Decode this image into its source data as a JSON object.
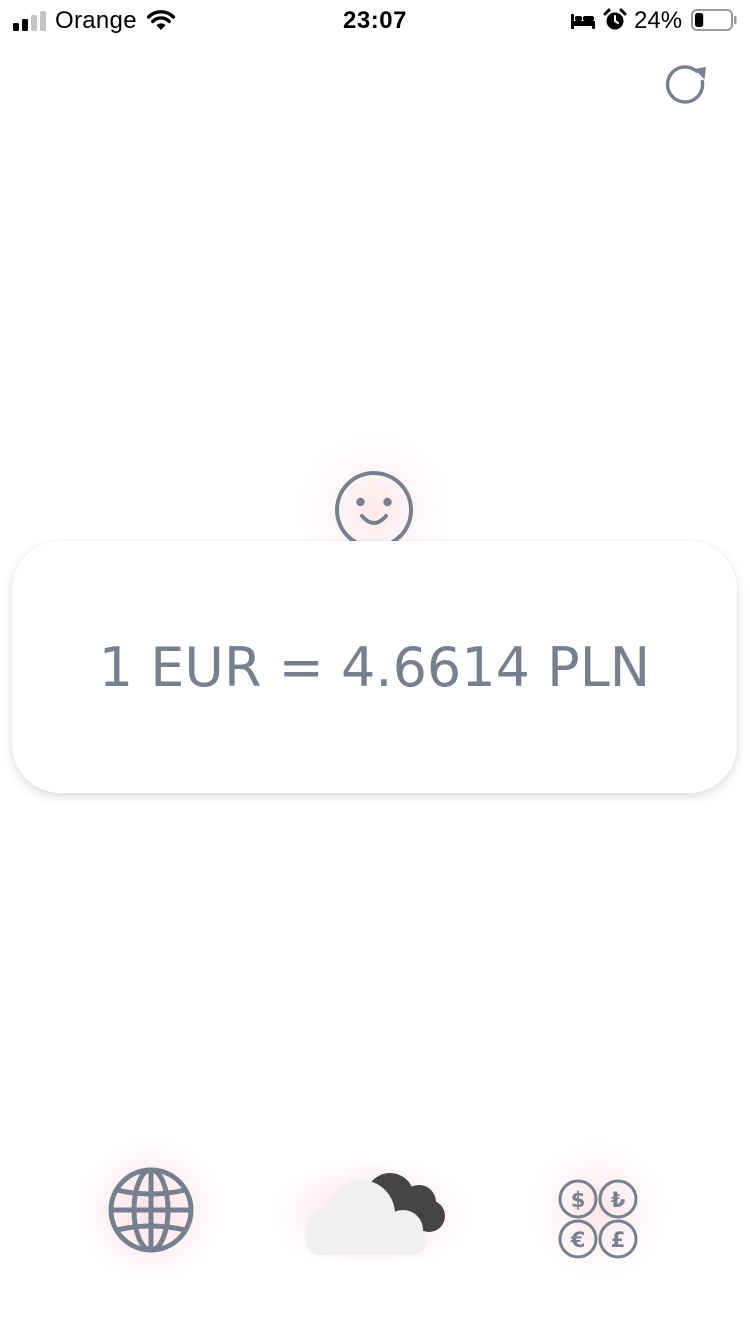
{
  "status_bar": {
    "carrier": "Orange",
    "time": "23:07",
    "battery_percent": "24%",
    "battery_level": 0.24,
    "signal_bars_active": 2,
    "signal_bars_total": 4
  },
  "main": {
    "rate_text": "1 EUR = 4.6614 PLN"
  },
  "icons": {
    "refresh": "refresh-icon",
    "mood": "smiley-face-icon",
    "globe": "globe-icon",
    "weather": "cloud-weather-icon",
    "currency": "currency-exchange-icon"
  },
  "colors": {
    "icon_gray": "#77808e",
    "glow_pink": "#ffd6dc",
    "cloud_light": "#f0f0f0",
    "cloud_dark": "#444444"
  }
}
